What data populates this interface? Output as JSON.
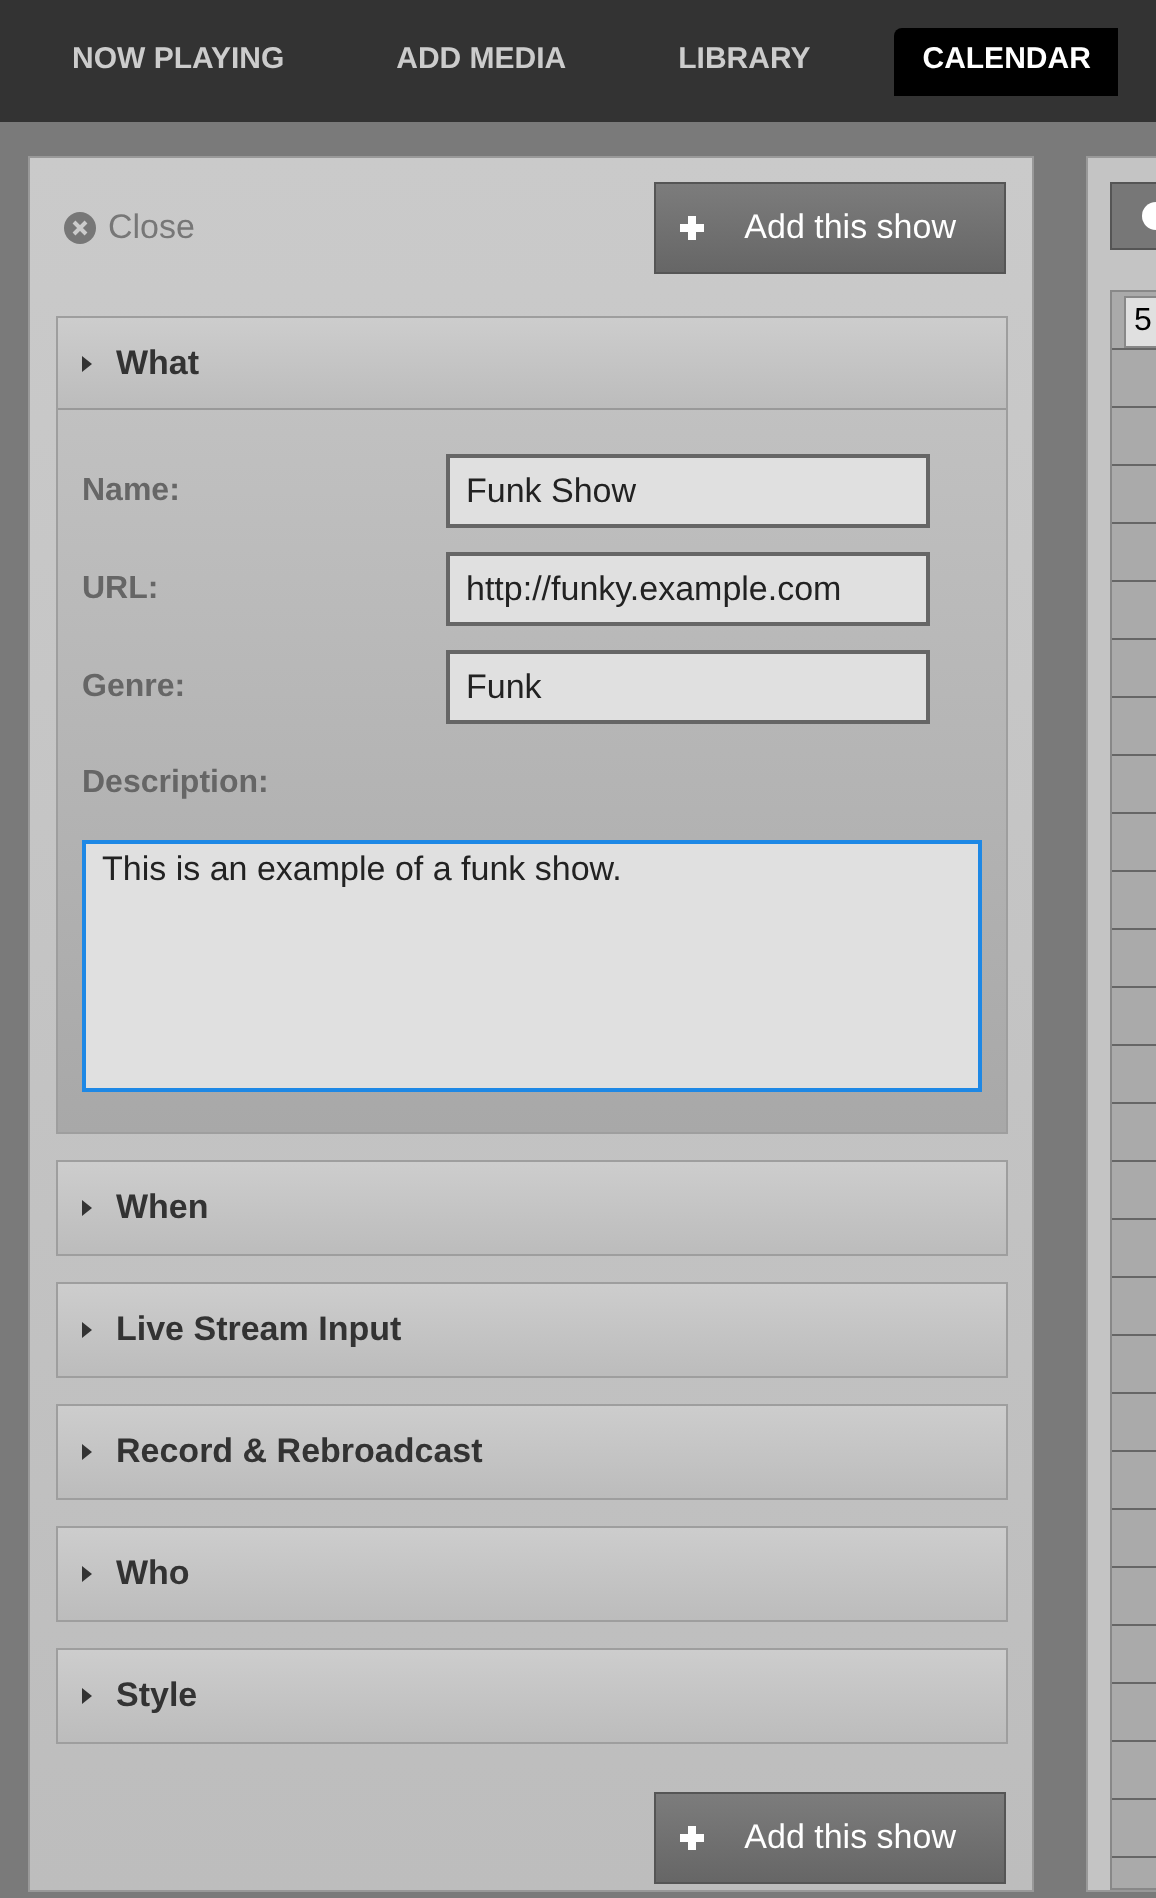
{
  "tabs": [
    {
      "label": "NOW PLAYING",
      "selected": false
    },
    {
      "label": "ADD MEDIA",
      "selected": false
    },
    {
      "label": "LIBRARY",
      "selected": false
    },
    {
      "label": "CALENDAR",
      "selected": true
    }
  ],
  "close_link": "Close",
  "add_button_top": "Add this show",
  "sections": [
    {
      "title": "What",
      "expanded": true,
      "fields": [
        {
          "label": "Name:",
          "value": "Funk Show"
        },
        {
          "label": "URL:",
          "value": "http://funky.example.com"
        },
        {
          "label": "Genre:",
          "value": "Funk"
        }
      ],
      "description": {
        "label": "Description:",
        "value": "This is an example of a funk show."
      }
    },
    {
      "title": "When",
      "expanded": false
    },
    {
      "title": "Live Stream Input",
      "expanded": false
    },
    {
      "title": "Record & Rebroadcast",
      "expanded": false
    },
    {
      "title": "Who",
      "expanded": false
    },
    {
      "title": "Style",
      "expanded": false
    }
  ],
  "add_button_bottom": "Add this show",
  "calendar_panel": {
    "field_value": "5"
  }
}
